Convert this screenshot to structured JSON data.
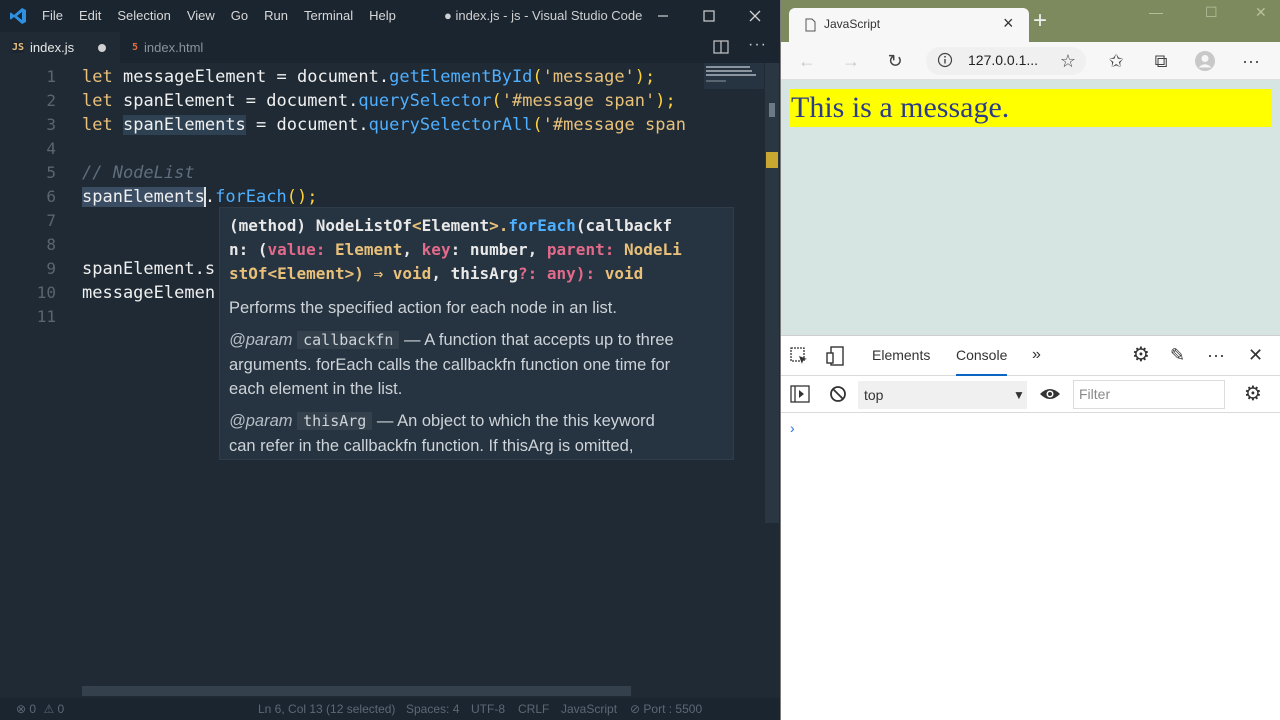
{
  "vscode": {
    "menu": [
      "File",
      "Edit",
      "Selection",
      "View",
      "Go",
      "Run",
      "Terminal",
      "Help"
    ],
    "title": "● index.js - js - Visual Studio Code",
    "tabs": [
      {
        "label": "index.js",
        "icon": "JS"
      },
      {
        "label": "index.html",
        "icon": "5"
      }
    ],
    "line_numbers": [
      "1",
      "2",
      "3",
      "4",
      "5",
      "6",
      "7",
      "8",
      "9",
      "10",
      "11"
    ],
    "code": {
      "l1": {
        "kw": "let",
        "id": "messageElement",
        "eq": " = ",
        "obj": "document",
        "dot": ".",
        "fn": "getElementById",
        "open": "(",
        "str": "'message'",
        "close": ");"
      },
      "l2": {
        "kw": "let",
        "id": "spanElement",
        "eq": " = ",
        "obj": "document",
        "dot": ".",
        "fn": "querySelector",
        "open": "(",
        "str": "'#message span'",
        "close": ");"
      },
      "l3": {
        "kw": "let",
        "id": "spanElements",
        "eq": " = ",
        "obj": "document",
        "dot": ".",
        "fn": "querySelectorAll",
        "open": "(",
        "str": "'#message span"
      },
      "l5": {
        "comment": "// NodeList"
      },
      "l6": {
        "id": "spanElements",
        "dot": ".",
        "fn": "forEach",
        "close": "();"
      },
      "l9": {
        "text": "spanElement.s"
      },
      "l10": {
        "text": "messageElemen"
      }
    },
    "hover": {
      "sig_prefix": "(method) NodeListOf",
      "sig_lt": "<",
      "sig_type1": "Element",
      "sig_gt": ">.",
      "sig_fn": "forEach",
      "sig_open": "(callbackf",
      "sig_line2a": "n: (",
      "sig_p_value": "value",
      "sig_colon1": ": ",
      "sig_type2": "Element",
      "sig_comma1": ", ",
      "sig_p_key": "key",
      "sig_colon2": ": number, ",
      "sig_p_parent": "parent",
      "sig_colon3": ": ",
      "sig_type3a": "NodeLi",
      "sig_type3b": "stOf",
      "sig_lt2": "<",
      "sig_type4": "Element",
      "sig_gt2": ">) ⇒ ",
      "sig_void1": "void",
      "sig_comma2": ", thisArg",
      "sig_q": "?: any): ",
      "sig_void2": "void",
      "desc": "Performs the specified action for each node in an list.",
      "param1_tag": "@param",
      "param1_name": "callbackfn",
      "param1_text1": " — A function that accepts up to three",
      "param1_text2": "arguments. forEach calls the callbackfn function one time for",
      "param1_text3": "each element in the list.",
      "param2_tag": "@param",
      "param2_name": "thisArg",
      "param2_text1": " — An object to which the this keyword",
      "param2_text2": "can refer in the callbackfn function. If thisArg is omitted,"
    },
    "status": {
      "errors": "0",
      "warnings": "0",
      "position": "Ln 6, Col 13 (12 selected)",
      "spaces": "Spaces: 4",
      "encoding": "UTF-8",
      "eol": "CRLF",
      "language": "JavaScript",
      "port": "Port : 5500"
    }
  },
  "browser": {
    "tab_title": "JavaScript",
    "url": "127.0.0.1...",
    "message": "This is a message.",
    "devtools": {
      "tabs": [
        "Elements",
        "Console"
      ],
      "active_tab": "Console",
      "context": "top",
      "filter_placeholder": "Filter",
      "prompt": "›"
    }
  },
  "colors": {
    "editor_bg": "#1f2a35",
    "browser_accent": "#7c8a5e",
    "message_bg": "#ffff00",
    "message_text": "#2c3c8c",
    "page_bg": "#d6e5e2"
  }
}
